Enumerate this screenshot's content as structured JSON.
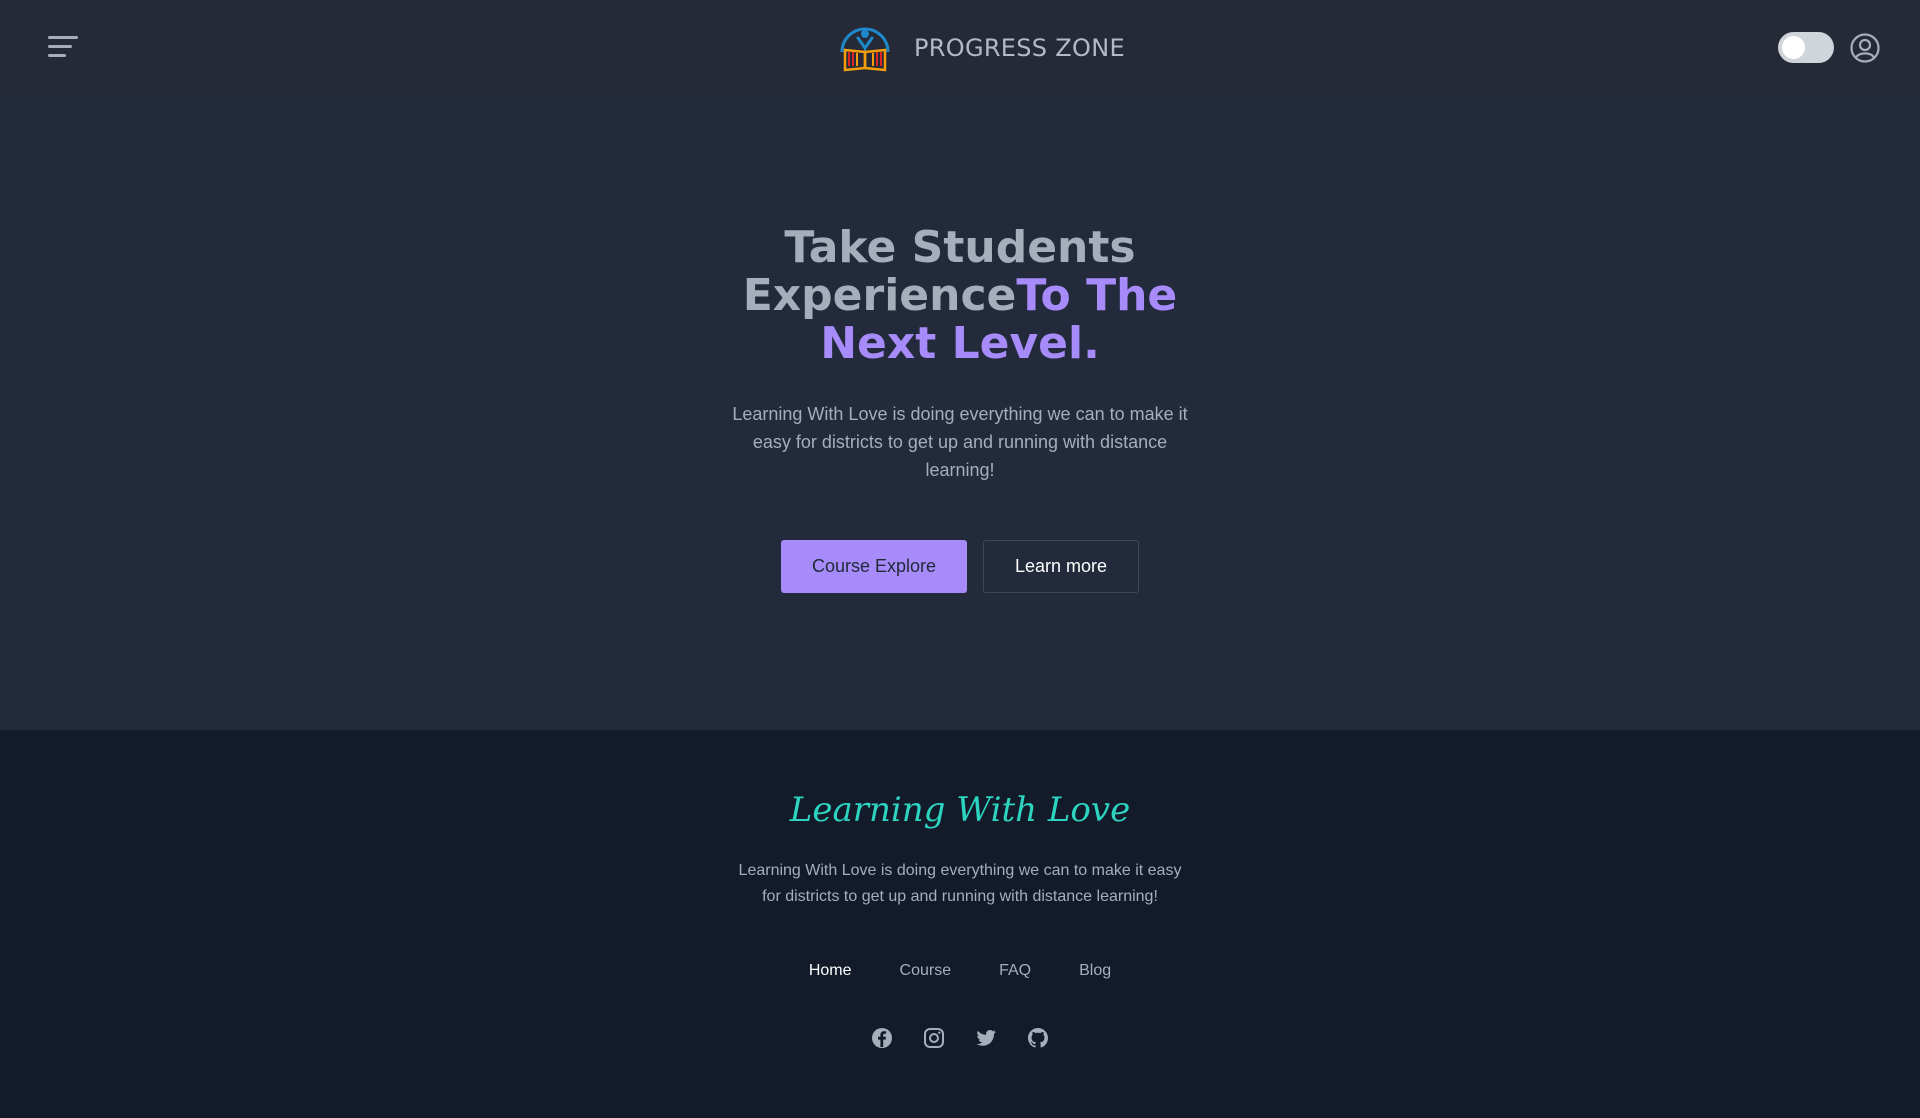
{
  "navbar": {
    "brand_name": "PROGRESS ZONE",
    "icons": [
      "hamburger-menu-icon",
      "logo-book-person",
      "theme-toggle",
      "user-circle-icon"
    ]
  },
  "hero": {
    "title_line1": "Take Students",
    "title_line2_plain": "Experience",
    "title_line2_accent": "To The",
    "title_line3_accent": "Next Level.",
    "description": "Learning With Love is doing everything we can to make it easy for districts to get up and running with distance learning!",
    "primary_button": "Course Explore",
    "secondary_button": "Learn more"
  },
  "footer": {
    "brand": "Learning With Love",
    "description": "Learning With Love is doing everything we can to make it easy for districts to get up and running with distance learning!",
    "links": [
      {
        "label": "Home"
      },
      {
        "label": "Course"
      },
      {
        "label": "FAQ"
      },
      {
        "label": "Blog"
      }
    ],
    "socials": [
      "facebook-icon",
      "instagram-icon",
      "twitter-icon",
      "github-icon"
    ]
  },
  "colors": {
    "accent": "#a78bfa",
    "brand_script": "#2dd4bf",
    "nav_bg": "#252a36",
    "hero_bg": "#222a3b",
    "footer_bg": "#131a2a"
  }
}
